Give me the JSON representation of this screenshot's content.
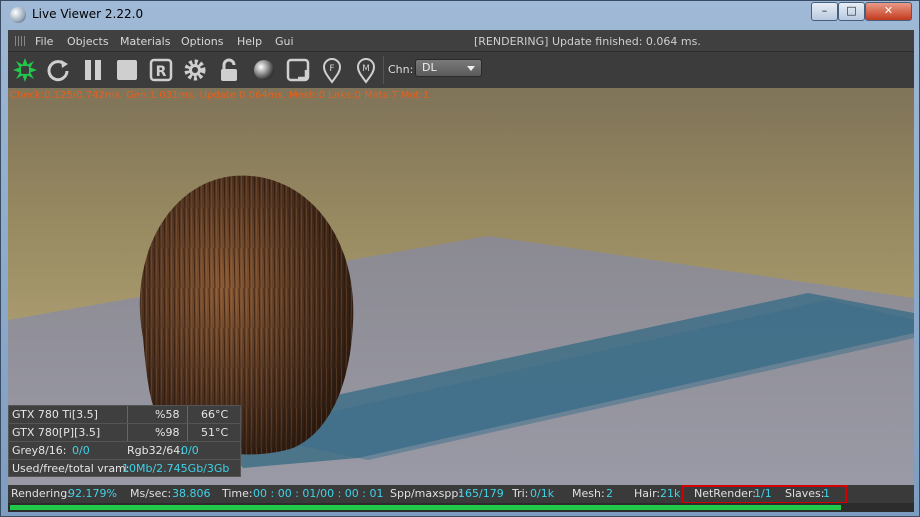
{
  "window": {
    "title": "Live Viewer 2.22.0",
    "controls": {
      "minimize": "–",
      "maximize": "□",
      "close": "✕"
    }
  },
  "menubar": {
    "items": [
      "File",
      "Objects",
      "Materials",
      "Options",
      "Help",
      "Gui"
    ],
    "status": "[RENDERING] Update finished: 0.064 ms."
  },
  "toolbar": {
    "icons": [
      "octane-logo-icon",
      "restart-icon",
      "pause-icon",
      "stop-icon",
      "region-render-icon",
      "settings-gear-icon",
      "lock-icon",
      "material-sphere-icon",
      "focus-pick-icon",
      "focus-marker-icon",
      "material-marker-icon"
    ],
    "channel_label": "Chn:",
    "channel_value": "DL",
    "accent": "#22c84a"
  },
  "viewport": {
    "stats_line": "Check:0.125/0.742ms. Gen:1.031ms. Update 0.064ms. Mesh:0 Lnks:0 Mats:7 Mot:1"
  },
  "gpu_panel": {
    "gpus": [
      {
        "name": "GTX 780 Ti[3.5]",
        "usage": "%58",
        "temp": "66°C"
      },
      {
        "name": "GTX 780[P][3.5]",
        "usage": "%98",
        "temp": "51°C"
      }
    ],
    "grey_label": "Grey8/16:",
    "grey_value": "0/0",
    "rgb_label": "Rgb32/64:",
    "rgb_value": "0/0",
    "vram_label": "Used/free/total vram:",
    "vram_value": "10Mb/2.745Gb/3Gb"
  },
  "statusbar": {
    "rendering_label": "Rendering:",
    "rendering_value": "92.179%",
    "ms_label": "Ms/sec:",
    "ms_value": "38.806",
    "time_label": "Time:",
    "time_value": "00 : 00 : 01/00 : 00 : 01",
    "spp_label": "Spp/maxspp:",
    "spp_value": "165/179",
    "tri_label": "Tri:",
    "tri_value": "0/1k",
    "mesh_label": "Mesh:",
    "mesh_value": "2",
    "hair_label": "Hair:",
    "hair_value": "21k",
    "netrender_label": "NetRender:",
    "netrender_value": "1/1",
    "slaves_label": "Slaves:",
    "slaves_value": "1",
    "progress": 0.92179,
    "highlight_color": "#d40000",
    "value_color": "#3fd3e8"
  }
}
